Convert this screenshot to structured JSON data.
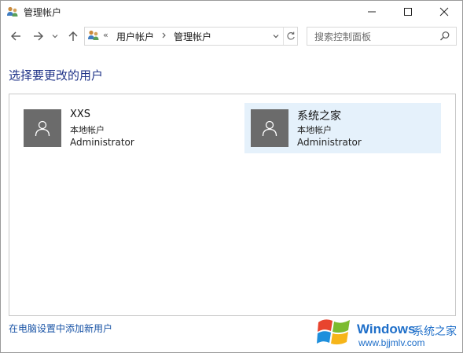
{
  "window": {
    "title": "管理帐户"
  },
  "nav": {
    "breadcrumb_overflow": "«",
    "breadcrumbs": [
      "用户帐户",
      "管理帐户"
    ],
    "search_placeholder": "搜索控制面板"
  },
  "main": {
    "heading": "选择要更改的用户",
    "accounts": [
      {
        "name": "XXS",
        "type": "本地帐户",
        "role": "Administrator",
        "selected": false
      },
      {
        "name": "系统之家",
        "type": "本地帐户",
        "role": "Administrator",
        "selected": true
      }
    ],
    "add_user_link": "在电脑设置中添加新用户"
  },
  "watermark": {
    "brand": "Windows",
    "brand_cn": "系统之家",
    "url": "www.bjjmlv.com"
  },
  "colors": {
    "heading": "#1e3287",
    "link": "#1a54a6",
    "selected_bg": "#e5f1fb",
    "avatar_bg": "#6b6b6b"
  }
}
